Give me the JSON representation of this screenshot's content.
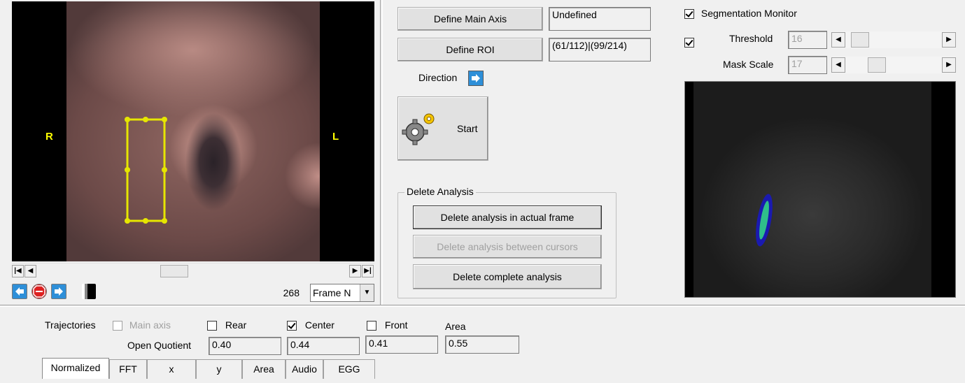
{
  "video": {
    "label_right": "R",
    "label_left": "L",
    "frame_number": "268",
    "frame_mode": "Frame N"
  },
  "axis": {
    "define_main_axis_label": "Define Main Axis",
    "main_axis_value": "Undefined",
    "define_roi_label": "Define ROI",
    "roi_value": "(61/112)|(99/214)",
    "direction_label": "Direction",
    "start_label": "Start"
  },
  "delete_group": {
    "title": "Delete Analysis",
    "actual_frame_label": "Delete analysis in actual frame",
    "between_cursors_label": "Delete analysis between cursors",
    "complete_label": "Delete complete analysis"
  },
  "segmentation": {
    "monitor_label": "Segmentation Monitor",
    "monitor_checked": true,
    "threshold_label": "Threshold",
    "threshold_checked": true,
    "threshold_value": "16",
    "mask_scale_label": "Mask Scale",
    "mask_scale_value": "17"
  },
  "trajectories": {
    "label": "Trajectories",
    "main_axis_label": "Main axis",
    "rear_label": "Rear",
    "center_label": "Center",
    "center_checked": true,
    "front_label": "Front",
    "area_label": "Area",
    "open_quotient_label": "Open Quotient",
    "values": [
      "0.40",
      "0.44",
      "0.41",
      "0.55"
    ]
  },
  "tabs": [
    "Normalized",
    "FFT",
    "x",
    "y",
    "Area",
    "Audio",
    "EGG"
  ],
  "colors": {
    "roi_box": "#e6e600",
    "arrow_button": "#2e8fd8",
    "stop_button": "#cc1d1d",
    "mask_outline": "#1a1ab0",
    "mask_fill": "#2fbf8a"
  }
}
